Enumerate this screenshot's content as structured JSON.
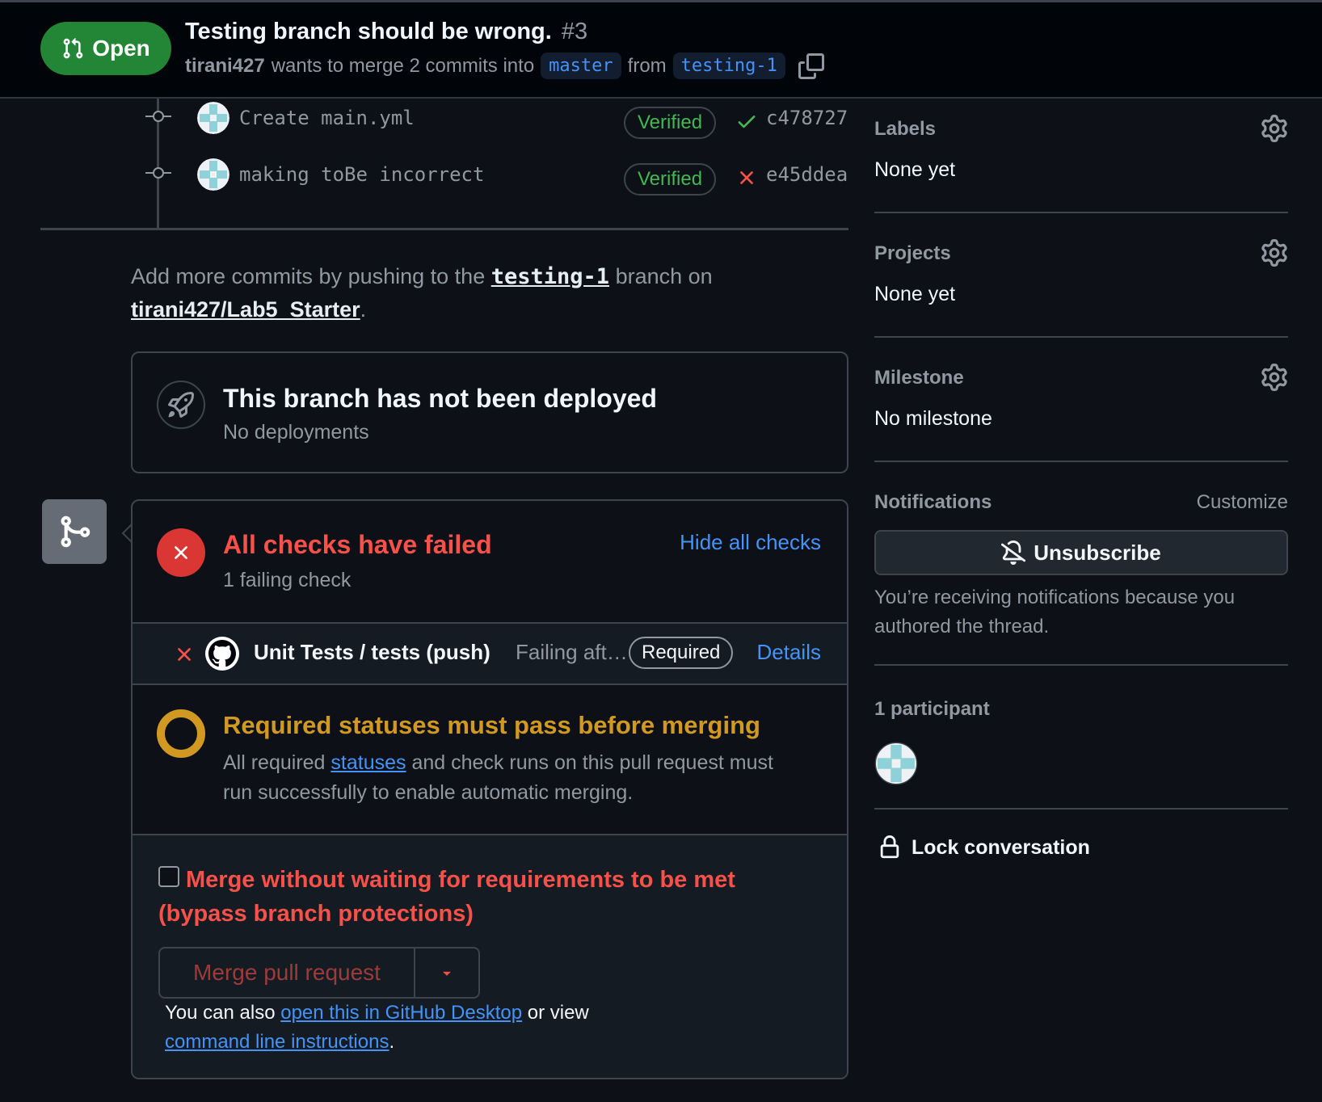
{
  "header": {
    "state_label": "Open",
    "title": "Testing branch should be wrong.",
    "number": "#3",
    "author": "tirani427",
    "merge_text": "wants to merge 2 commits into",
    "base_branch": "master",
    "from_text": "from",
    "head_branch": "testing-1"
  },
  "commits": [
    {
      "message": "Create main.yml",
      "verified": "Verified",
      "status": "success",
      "sha": "c478727"
    },
    {
      "message": "making toBe incorrect",
      "verified": "Verified",
      "status": "failure",
      "sha": "e45ddea"
    }
  ],
  "add_commits": {
    "prefix": "Add more commits by pushing to the",
    "branch": "testing-1",
    "middle": "branch on",
    "repo": "tirani427/Lab5_Starter",
    "suffix": "."
  },
  "deployment": {
    "title": "This branch has not been deployed",
    "subtitle": "No deployments"
  },
  "checks": {
    "title": "All checks have failed",
    "subtitle": "1 failing check",
    "toggle_label": "Hide all checks",
    "items": [
      {
        "name": "Unit Tests / tests (push)",
        "description": "Failing aft…",
        "badge": "Required",
        "link": "Details"
      }
    ]
  },
  "required_statuses": {
    "title": "Required statuses must pass before merging",
    "desc_prefix": "All required",
    "desc_link": "statuses",
    "desc_suffix": "and check runs on this pull request must run successfully to enable automatic merging."
  },
  "merge": {
    "bypass_label": "Merge without waiting for requirements to be met (bypass branch protections)",
    "bypass_checked": false,
    "button_label": "Merge pull request",
    "help_prefix": "You can also",
    "help_link1": "open this in GitHub Desktop",
    "help_middle": "or view",
    "help_link2": "command line instructions",
    "help_suffix": "."
  },
  "sidebar": {
    "labels": {
      "heading": "Labels",
      "value": "None yet"
    },
    "projects": {
      "heading": "Projects",
      "value": "None yet"
    },
    "milestone": {
      "heading": "Milestone",
      "value": "No milestone"
    },
    "notifications": {
      "heading": "Notifications",
      "customize": "Customize",
      "button": "Unsubscribe",
      "description": "You’re receiving notifications because you authored the thread."
    },
    "participants": {
      "heading": "1 participant"
    },
    "lock": "Lock conversation"
  },
  "colors": {
    "open_green": "#238636",
    "verified_green": "#3fb950",
    "danger_red": "#f85149",
    "attention_yellow": "#d29922",
    "link_blue": "#4493f8"
  },
  "icons": [
    "git-pull-request-icon",
    "copy-icon",
    "commit-node-icon",
    "check-icon",
    "x-icon",
    "rocket-icon",
    "git-merge-icon",
    "github-logo-icon",
    "triangle-down-icon",
    "gear-icon",
    "bell-slash-icon",
    "lock-icon"
  ]
}
